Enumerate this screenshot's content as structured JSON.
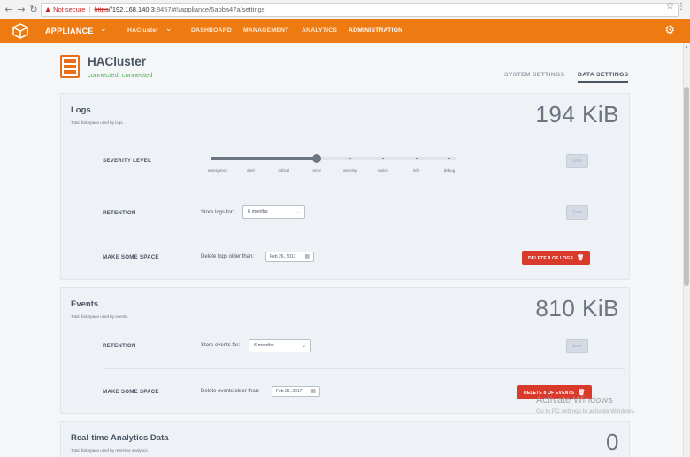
{
  "browser": {
    "back_icon": "back-arrow-icon",
    "forward_icon": "forward-arrow-icon",
    "reload_icon": "reload-icon",
    "security_label": "Not secure",
    "url_scheme": "https",
    "url_host": "//192.168.140.3",
    "url_path": ":8457/#!/appliance/6abba47a/settings"
  },
  "topnav": {
    "brand": "APPLIANCE",
    "cluster": "HACluster",
    "items": [
      "DASHBOARD",
      "MANAGEMENT",
      "ANALYTICS",
      "ADMINISTRATION"
    ],
    "active_item": "ADMINISTRATION",
    "accent_color": "#ee7a12"
  },
  "header": {
    "title": "HACluster",
    "status": "connected, connected",
    "status_color": "#4caf50",
    "tabs": [
      "SYSTEM SETTINGS",
      "DATA SETTINGS"
    ],
    "active_tab": "DATA SETTINGS"
  },
  "logs": {
    "title": "Logs",
    "subtitle": "Total disk space used by logs.",
    "size": "194 KiB",
    "severity_label": "SEVERITY LEVEL",
    "severity_levels": [
      "emergency",
      "alert",
      "critical",
      "error",
      "warning",
      "notice",
      "info",
      "debug"
    ],
    "severity_selected": "error",
    "save_label": "Save",
    "retention_label": "RETENTION",
    "retention_field": "Store logs for:",
    "retention_value": "6 months",
    "space_label": "MAKE SOME SPACE",
    "space_field": "Delete logs older than:",
    "space_date": "Feb 26, 2017",
    "delete_button": "DELETE 8 OF LOGS"
  },
  "events": {
    "title": "Events",
    "subtitle": "Total disk space used by events.",
    "size": "810 KiB",
    "retention_label": "RETENTION",
    "retention_field": "Store events for:",
    "retention_value": "6 months",
    "save_label": "Save",
    "space_label": "MAKE SOME SPACE",
    "space_field": "Delete events older than:",
    "space_date": "Feb 26, 2017",
    "delete_button": "DELETE 8 OF EVENTS"
  },
  "realtime": {
    "title": "Real-time Analytics Data",
    "subtitle": "Total disk space used by real-time analytics.",
    "size": "0"
  },
  "watermark": {
    "line1": "Activate Windows",
    "line2": "Go to PC settings to activate Windows."
  }
}
